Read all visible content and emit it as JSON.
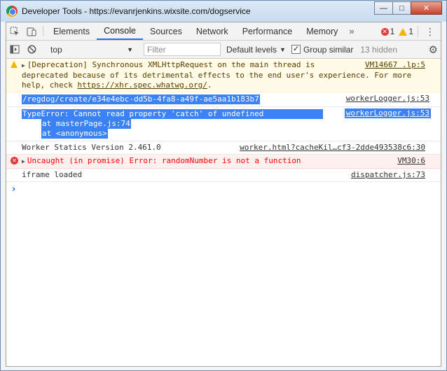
{
  "window": {
    "title": "Developer Tools - https://evanrjenkins.wixsite.com/dogservice",
    "controls": {
      "minimize": "—",
      "maximize": "□",
      "close": "✕"
    }
  },
  "tabbar": {
    "tabs": [
      "Elements",
      "Console",
      "Sources",
      "Network",
      "Performance",
      "Memory"
    ],
    "active": "Console",
    "more": "»",
    "error_count": "1",
    "warning_count": "1",
    "kebab": "⋮"
  },
  "toolbar": {
    "context": "top",
    "filter_placeholder": "Filter",
    "levels": "Default levels",
    "group_similar_label": "Group similar",
    "group_similar_checked": true,
    "hidden": "13 hidden"
  },
  "messages": [
    {
      "level": "warning",
      "lines": [
        "[Deprecation] Synchronous XMLHttpRequest on the main thread is",
        "deprecated because of its detrimental effects to the end user's experience. For more"
      ],
      "help_prefix": "help, check ",
      "help_link": "https://xhr.spec.whatwg.org/",
      "help_suffix": ".",
      "source": "VM14667 .lp:5"
    },
    {
      "level": "selected",
      "text": "/regdog/create/e34e4ebc-dd5b-4fa8-a49f-ae5aa1b183b7",
      "source": "workerLogger.js:53"
    },
    {
      "level": "selected",
      "text": "TypeError: Cannot read property 'catch' of undefined",
      "stack": [
        "at masterPage.js:74",
        "at <anonymous>"
      ],
      "source": "workerLogger.js:53"
    },
    {
      "level": "info",
      "text": "Worker Statics Version 2.461.0",
      "source": "worker.html?cacheKil…cf3-2dde493538c6:30"
    },
    {
      "level": "error",
      "text": "Uncaught (in promise) Error: randomNumber is not a function",
      "source": "VM30:6"
    },
    {
      "level": "info",
      "text": "iframe loaded",
      "source": "dispatcher.js:73"
    }
  ],
  "prompt": "›",
  "colors": {
    "accent": "#1a73e8",
    "selection": "#3b82f6",
    "error": "#ff0000",
    "warning_bg": "#fffbe6",
    "error_bg": "#fff0f0"
  }
}
